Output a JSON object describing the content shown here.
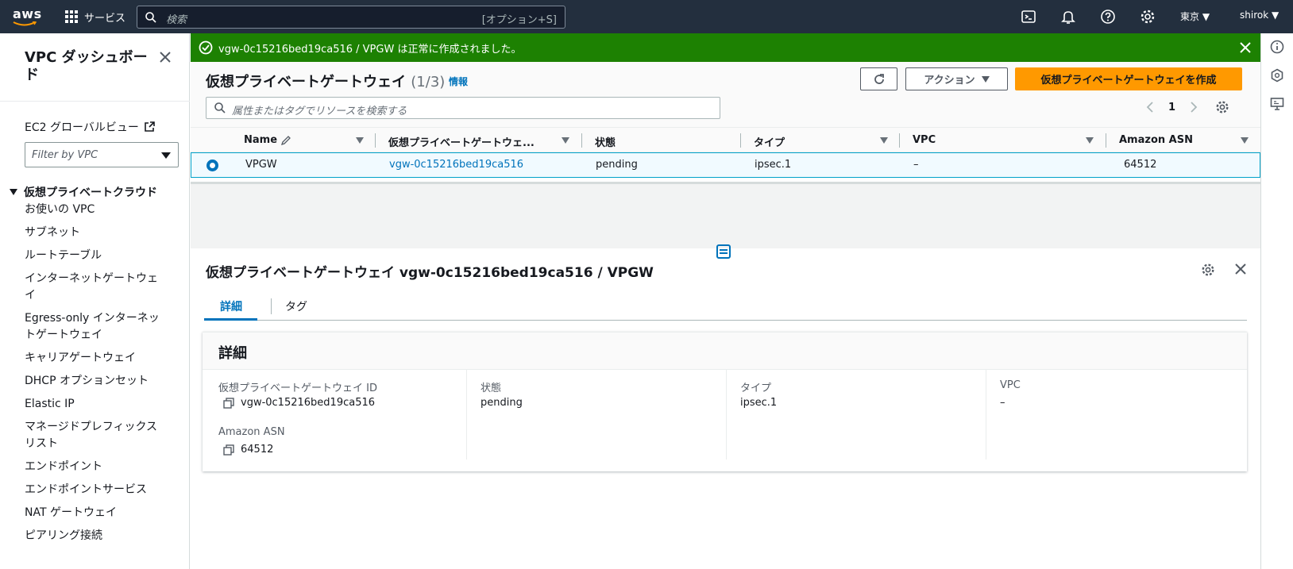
{
  "topbar": {
    "logo": "aws",
    "services_label": "サービス",
    "search_placeholder": "検索",
    "search_shortcut": "[オプション+S]",
    "region": "東京 ▼",
    "user": "shirok ▼",
    "bg_color": "#232f3e"
  },
  "sidebar": {
    "title": "VPC ダッシュボード",
    "ec2_global_view": "EC2 グローバルビュー",
    "filter_placeholder": "Filter by VPC",
    "section": "仮想プライベートクラウド",
    "items": [
      "お使いの VPC",
      "サブネット",
      "ルートテーブル",
      "インターネットゲートウェイ",
      "Egress-only インターネットゲートウェイ",
      "キャリアゲートウェイ",
      "DHCP オプションセット",
      "Elastic IP",
      "マネージドプレフィックスリスト",
      "エンドポイント",
      "エンドポイントサービス",
      "NAT ゲートウェイ",
      "ピアリング接続"
    ]
  },
  "banner": {
    "message": "vgw-0c15216bed19ca516 / VPGW は正常に作成されました。",
    "color": "#1d8102"
  },
  "list": {
    "title": "仮想プライベートゲートウェイ",
    "count": "(1/3)",
    "info": "情報",
    "actions_label": "アクション",
    "create_label": "仮想プライベートゲートウェイを作成",
    "search_placeholder": "属性またはタグでリソースを検索する",
    "page": "1",
    "columns": [
      "Name",
      "仮想プライベートゲートウェ...",
      "状態",
      "タイプ",
      "VPC",
      "Amazon ASN"
    ],
    "rows": [
      {
        "name": "VPGW",
        "id": "vgw-0c15216bed19ca516",
        "state": "pending",
        "type": "ipsec.1",
        "vpc": "–",
        "asn": "64512"
      }
    ]
  },
  "detail": {
    "title": "仮想プライベートゲートウェイ vgw-0c15216bed19ca516 / VPGW",
    "tabs": [
      "詳細",
      "タグ"
    ],
    "card_title": "詳細",
    "fields": {
      "id_label": "仮想プライベートゲートウェイ ID",
      "id_value": "vgw-0c15216bed19ca516",
      "asn_label": "Amazon ASN",
      "asn_value": "64512",
      "state_label": "状態",
      "state_value": "pending",
      "type_label": "タイプ",
      "type_value": "ipsec.1",
      "vpc_label": "VPC",
      "vpc_value": "–"
    }
  },
  "colors": {
    "primary_button": "#ff9900",
    "link": "#0073bb",
    "selected_row": "#f1faff"
  }
}
